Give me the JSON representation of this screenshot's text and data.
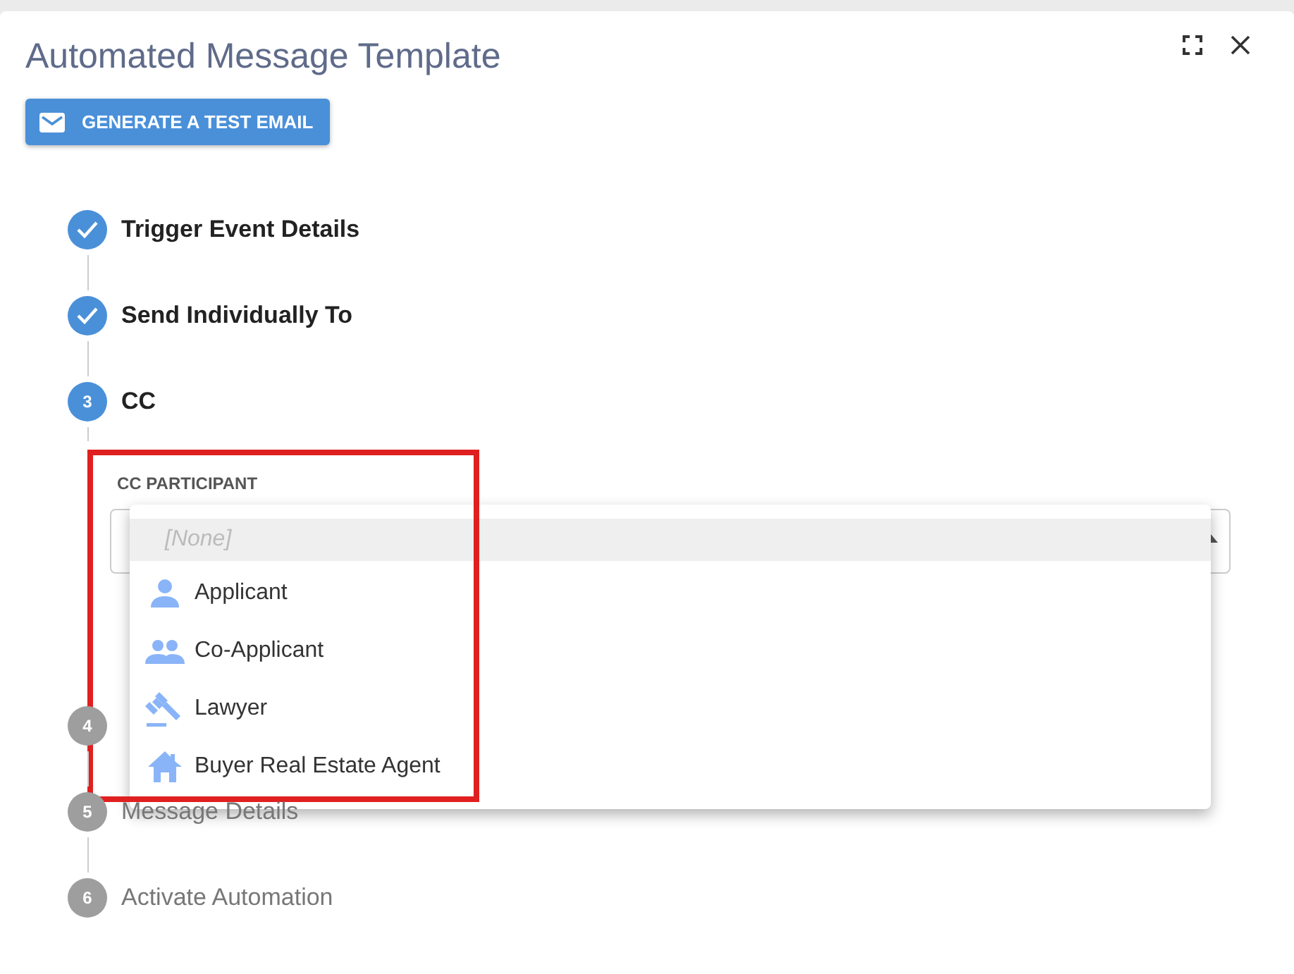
{
  "dialog": {
    "title": "Automated Message Template"
  },
  "test_button": {
    "label": "GENERATE A TEST EMAIL"
  },
  "steps": [
    {
      "label": "Trigger Event Details",
      "completed": true
    },
    {
      "label": "Send Individually To",
      "completed": true
    },
    {
      "number": "3",
      "label": "CC",
      "completed": false,
      "active": true,
      "field": {
        "label": "CC PARTICIPANT",
        "options": [
          {
            "label": "[None]",
            "kind": "none",
            "selected": true
          },
          {
            "label": "Applicant",
            "kind": "person",
            "selected": false
          },
          {
            "label": "Co-Applicant",
            "kind": "people",
            "selected": false
          },
          {
            "label": "Lawyer",
            "kind": "gavel",
            "selected": false
          },
          {
            "label": "Buyer Real Estate Agent",
            "kind": "house",
            "selected": false
          }
        ]
      }
    },
    {
      "number": "4",
      "completed": false,
      "active": false
    },
    {
      "number": "5",
      "label": "Message Details",
      "completed": false,
      "active": false
    },
    {
      "number": "6",
      "label": "Activate Automation",
      "completed": false,
      "active": false
    }
  ]
}
